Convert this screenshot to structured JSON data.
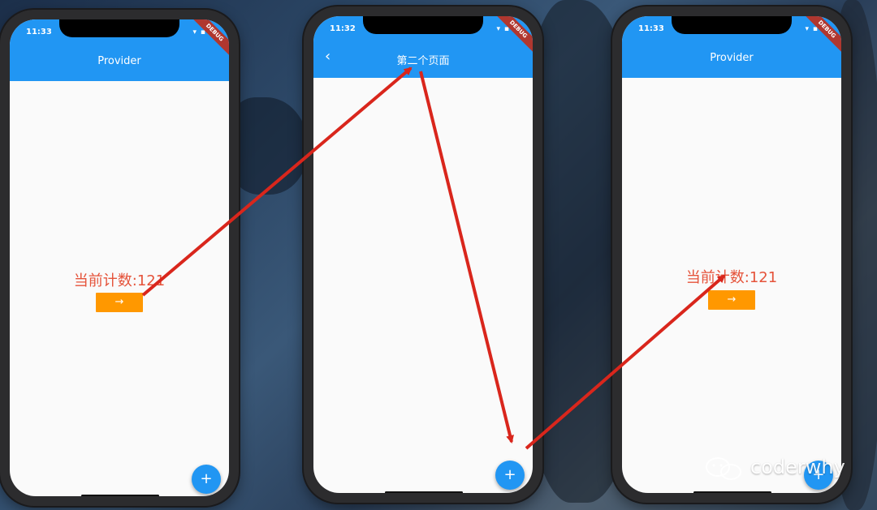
{
  "phones": [
    {
      "time": "11:33",
      "title": "Provider",
      "has_back": false,
      "counter": "当前计数:121",
      "button": "→",
      "fab": "+",
      "debug": "DEBUG"
    },
    {
      "time": "11:32",
      "title": "第二个页面",
      "has_back": true,
      "back": "‹",
      "fab": "+",
      "debug": "DEBUG"
    },
    {
      "time": "11:33",
      "title": "Provider",
      "has_back": false,
      "counter": "当前计数:121",
      "button": "→",
      "fab": "+",
      "debug": "DEBUG"
    }
  ],
  "status_icons": "▾ ▪",
  "watermark": "coderwhy",
  "colors": {
    "appbar": "#2196f3",
    "button": "#ff9800",
    "counter_text": "#e5533a",
    "annotation_arrow": "#d9261c"
  }
}
